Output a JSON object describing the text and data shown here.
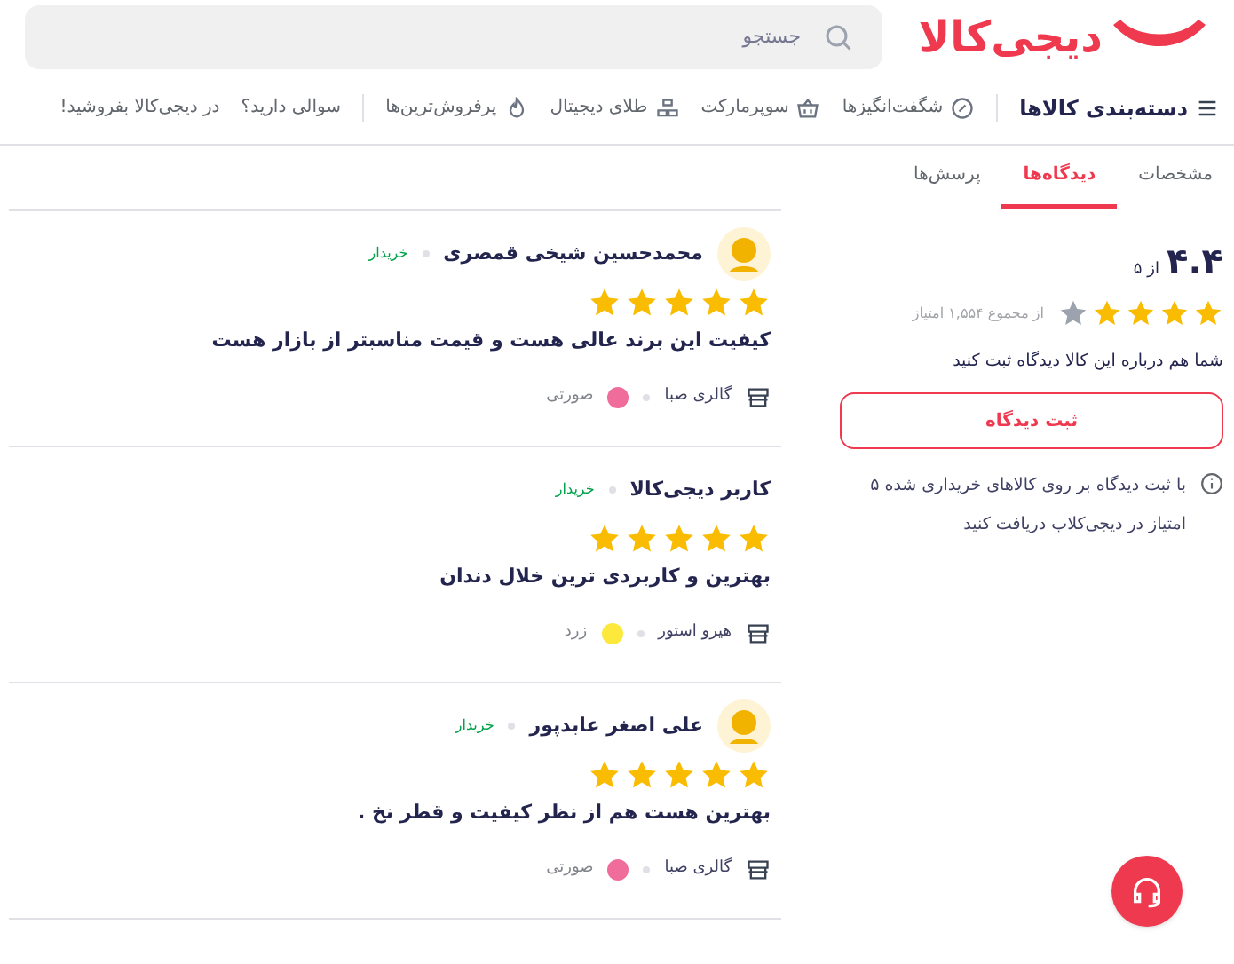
{
  "header": {
    "logo": "دیجی‌کالا",
    "search": {
      "placeholder": "جستجو"
    }
  },
  "nav": [
    {
      "label": "دسته‌بندی کالاها",
      "kind": "menu"
    },
    {
      "label": "شگفت‌انگیزها",
      "kind": "percent"
    },
    {
      "label": "سوپرمارکت",
      "kind": "basket"
    },
    {
      "label": "طلای دیجیتال",
      "kind": "gold"
    },
    {
      "label": "پرفروش‌ترین‌ها",
      "kind": "flame"
    },
    {
      "label": "سوالی دارید؟",
      "kind": "plain"
    },
    {
      "label": "در دیجی‌کالا بفروشید!",
      "kind": "plain"
    }
  ],
  "tabs": [
    {
      "label": "مشخصات",
      "selected": false
    },
    {
      "label": "دیدگاه‌ها",
      "selected": true
    },
    {
      "label": "پرسش‌ها",
      "selected": false
    }
  ],
  "summary": {
    "score": "۴.۴",
    "out_of": "از ۵",
    "stars": 4,
    "total": "از مجموع ۱,۵۵۴ امتیاز",
    "prompt": "شما هم درباره این کالا دیدگاه ثبت کنید",
    "button": "ثبت دیدگاه",
    "note": "با ثبت دیدگاه بر روی کالاهای خریداری شده ۵ امتیاز در دیجی‌کلاب دریافت کنید"
  },
  "reviews": [
    {
      "author": "محمدحسین شیخی قمصری",
      "avatar": true,
      "badge": "خریدار",
      "stars": 5,
      "text": "کیفیت این برند عالی هست و قیمت مناسبتر از بازار هست",
      "seller": "گالری صبا",
      "color_name": "صورتی",
      "color": "#f06c9b"
    },
    {
      "author": "کاربر دیجی‌کالا",
      "avatar": false,
      "badge": "خریدار",
      "stars": 5,
      "text": "بهترین و کاربردی ترین خلال دندان",
      "seller": "هیرو استور",
      "color_name": "زرد",
      "color": "#fde93c"
    },
    {
      "author": "علی اصغر عابدپور",
      "avatar": true,
      "badge": "خریدار",
      "stars": 5,
      "text": "بهترین هست هم از نظر کیفیت و قطر نخ .",
      "seller": "گالری صبا",
      "color_name": "صورتی",
      "color": "#f06c9b"
    }
  ]
}
